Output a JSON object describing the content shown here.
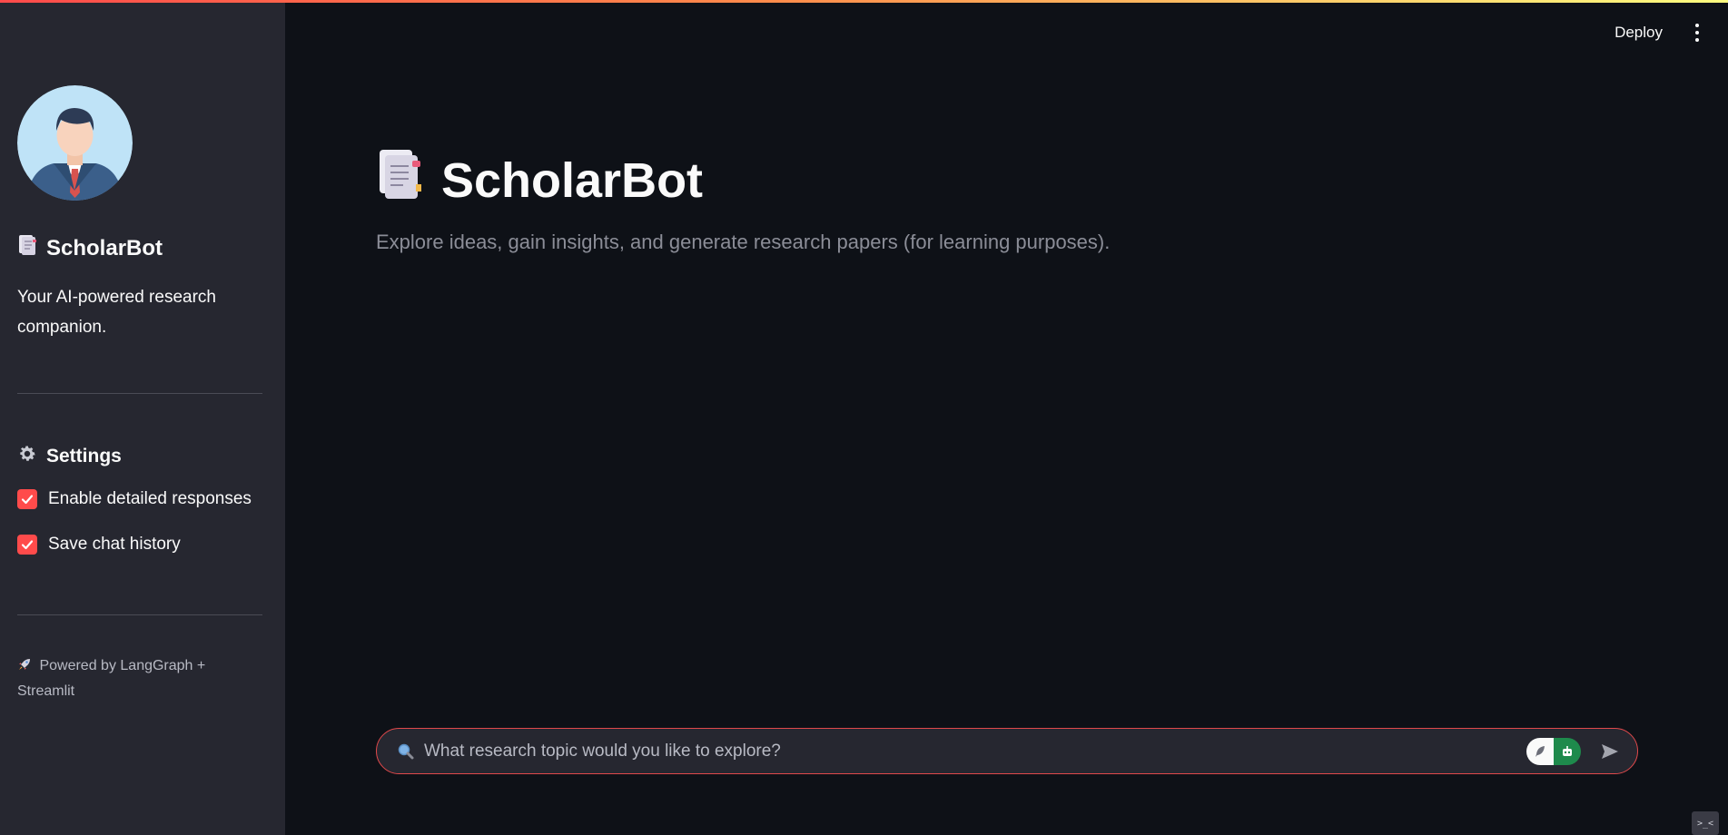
{
  "app": {
    "deploy_label": "Deploy"
  },
  "sidebar": {
    "title": "ScholarBot",
    "tagline": "Your AI-powered research companion.",
    "settings_heading": "Settings",
    "checkboxes": [
      {
        "label": "Enable detailed responses",
        "checked": true
      },
      {
        "label": "Save chat history",
        "checked": true
      }
    ],
    "footer": "Powered by LangGraph + Streamlit"
  },
  "main": {
    "title": "ScholarBot",
    "subtitle": "Explore ideas, gain insights, and generate research papers (for learning purposes)."
  },
  "chat": {
    "placeholder": "What research topic would you like to explore?"
  },
  "colors": {
    "background": "#0e1117",
    "sidebar": "#262730",
    "accent": "#ff4b4b"
  }
}
